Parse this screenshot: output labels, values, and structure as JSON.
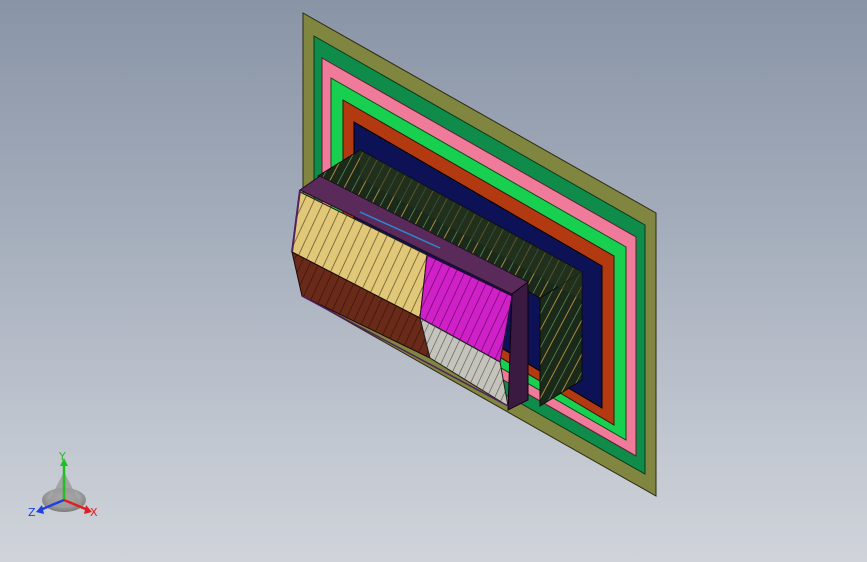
{
  "triad": {
    "y_label": "Y",
    "z_label": "Z",
    "x_label": "X"
  },
  "colors": {
    "background_top": "#8994a6",
    "background_bottom": "#d0d4da",
    "plate_outer": "#80853f",
    "plate_green_dark": "#0f8c4a",
    "plate_pink": "#f07a9a",
    "plate_green_bright": "#18d050",
    "plate_orange": "#b33a10",
    "plate_navy": "#0d1155",
    "box_tan": "#e0c878",
    "box_brown": "#6a2a1a",
    "box_magenta": "#d020c8",
    "box_gray": "#b8b8b0",
    "axis_x": "#e02020",
    "axis_y": "#20c020",
    "axis_z": "#2040e0"
  }
}
